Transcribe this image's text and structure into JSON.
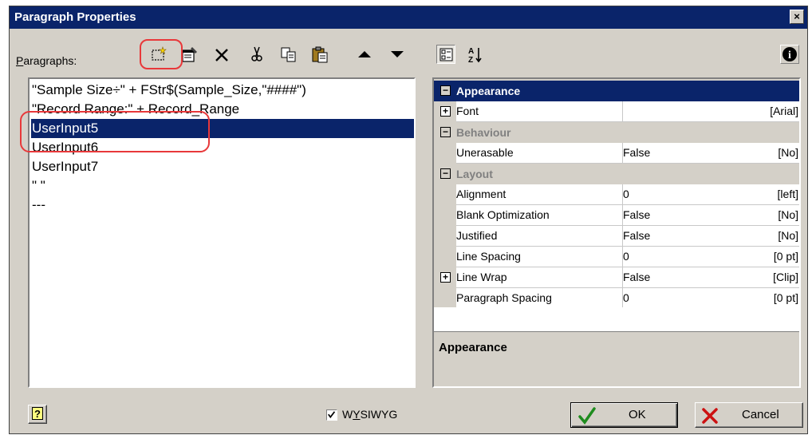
{
  "window": {
    "title": "Paragraph Properties",
    "close_glyph": "×"
  },
  "paragraphs": {
    "label": "Paragraphs:",
    "label_mnemonic": "P",
    "label_rest": "aragraphs:",
    "items": [
      {
        "text": "\"Sample Size÷\" + FStr$(Sample_Size,\"####\")",
        "selected": false
      },
      {
        "text": "\"Record Range:\" + Record_Range",
        "selected": false
      },
      {
        "text": "UserInput5",
        "selected": true
      },
      {
        "text": "UserInput6",
        "selected": false
      },
      {
        "text": "UserInput7",
        "selected": false
      },
      {
        "text": "\" \"",
        "selected": false
      },
      {
        "text": "---",
        "selected": false
      }
    ]
  },
  "toolbar": {
    "icons": [
      "new-paragraph-icon",
      "properties-icon",
      "delete-icon",
      "cut-icon",
      "copy-icon",
      "paste-icon",
      "move-up-icon",
      "move-down-icon"
    ]
  },
  "property_toolbar": {
    "icons": [
      "categorized-view-icon",
      "sort-alphabetical-icon",
      "info-icon"
    ],
    "info_glyph": "i",
    "sort_glyph_top": "A",
    "sort_glyph_bottom": "Z"
  },
  "properties": {
    "categories": [
      {
        "name": "Appearance",
        "active": true,
        "expander": "−",
        "props": [
          {
            "name": "Font",
            "value": "",
            "display": "[Arial]",
            "expandable": true
          }
        ]
      },
      {
        "name": "Behaviour",
        "active": false,
        "expander": "−",
        "props": [
          {
            "name": "Unerasable",
            "value": "False",
            "display": "[No]",
            "expandable": false
          }
        ]
      },
      {
        "name": "Layout",
        "active": false,
        "expander": "−",
        "props": [
          {
            "name": "Alignment",
            "value": "0",
            "display": "[left]",
            "expandable": false
          },
          {
            "name": "Blank Optimization",
            "value": "False",
            "display": "[No]",
            "expandable": false
          },
          {
            "name": "Justified",
            "value": "False",
            "display": "[No]",
            "expandable": false
          },
          {
            "name": "Line Spacing",
            "value": "0",
            "display": "[0 pt]",
            "expandable": false
          },
          {
            "name": "Line Wrap",
            "value": "False",
            "display": "[Clip]",
            "expandable": true
          },
          {
            "name": "Paragraph Spacing",
            "value": "0",
            "display": "[0 pt]",
            "expandable": false
          }
        ]
      }
    ],
    "description_title": "Appearance"
  },
  "footer": {
    "help_glyph": "?",
    "wysiwyg_label_pre": "W",
    "wysiwyg_label_mnemonic": "Y",
    "wysiwyg_label_post": "SIWYG",
    "wysiwyg_checked": true,
    "ok_label": "OK",
    "cancel_label": "Cancel"
  },
  "colors": {
    "titlebar": "#0a246a",
    "selection": "#0a246a",
    "dialog_face": "#d4d0c8",
    "annotation": "#e8383a",
    "ok_check": "#1e8c1e",
    "cancel_x": "#cc1111"
  }
}
